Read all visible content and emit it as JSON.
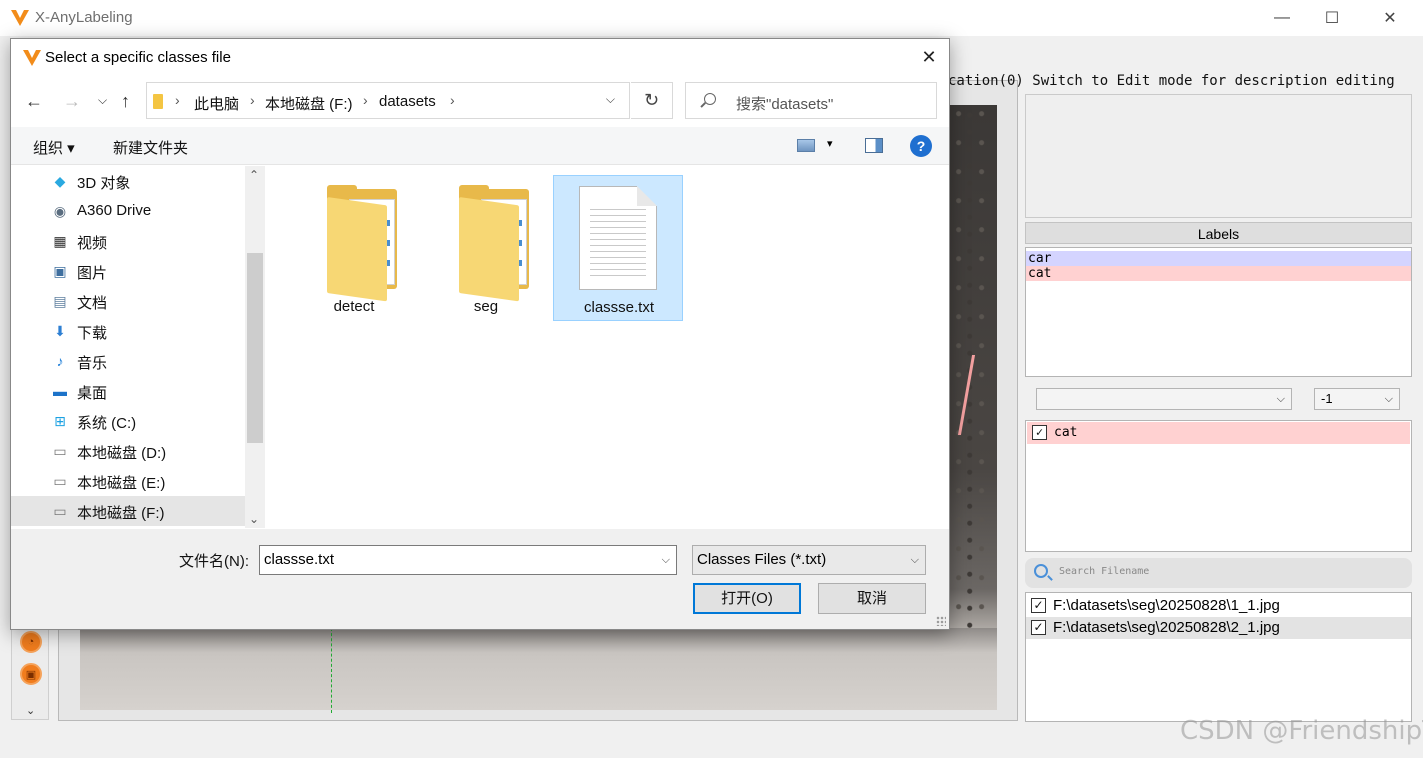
{
  "app": {
    "title": "X-AnyLabeling",
    "minimize": "—",
    "maximize": "☐",
    "close": "✕"
  },
  "main": {
    "hint": "cation(0) Switch to Edit mode for description editing",
    "labels_header": "Labels",
    "labels": [
      {
        "name": "car",
        "color": "#d4d4ff"
      },
      {
        "name": "cat",
        "color": "#ffd1d1"
      }
    ],
    "group_combo": "",
    "group_id_combo": "-1",
    "shapes": [
      {
        "label": "cat",
        "checked": true
      }
    ],
    "search_filename_placeholder": "Search Filename",
    "files": [
      {
        "path": "F:\\datasets\\seg\\20250828\\1_1.jpg",
        "checked": true,
        "selected": false
      },
      {
        "path": "F:\\datasets\\seg\\20250828\\2_1.jpg",
        "checked": true,
        "selected": true
      }
    ],
    "watermark": "CSDN @FriendshipT"
  },
  "dialog": {
    "title": "Select a specific classes file",
    "breadcrumb": [
      "此电脑",
      "本地磁盘 (F:)",
      "datasets"
    ],
    "search_placeholder": "搜索\"datasets\"",
    "toolbar": {
      "organize": "组织 ▾",
      "new_folder": "新建文件夹",
      "help": "?"
    },
    "nav_items": [
      {
        "label": "3D 对象",
        "icon": "cube-icon",
        "glyph": "◆",
        "color": "#2aa9e0"
      },
      {
        "label": "A360 Drive",
        "icon": "cloud-drive-icon",
        "glyph": "◉",
        "color": "#5a6d80"
      },
      {
        "label": "视频",
        "icon": "video-icon",
        "glyph": "▦",
        "color": "#333333"
      },
      {
        "label": "图片",
        "icon": "picture-icon",
        "glyph": "▣",
        "color": "#3f6f9f"
      },
      {
        "label": "文档",
        "icon": "document-icon",
        "glyph": "▤",
        "color": "#5f7f9f"
      },
      {
        "label": "下载",
        "icon": "download-icon",
        "glyph": "⬇",
        "color": "#2d7fd3"
      },
      {
        "label": "音乐",
        "icon": "music-icon",
        "glyph": "♪",
        "color": "#1e7ed8"
      },
      {
        "label": "桌面",
        "icon": "desktop-icon",
        "glyph": "▬",
        "color": "#1d73c9"
      },
      {
        "label": "系统 (C:)",
        "icon": "windows-drive-icon",
        "glyph": "⊞",
        "color": "#1ba1e2"
      },
      {
        "label": "本地磁盘 (D:)",
        "icon": "drive-icon",
        "glyph": "▭",
        "color": "#777777"
      },
      {
        "label": "本地磁盘 (E:)",
        "icon": "drive-icon",
        "glyph": "▭",
        "color": "#777777"
      },
      {
        "label": "本地磁盘 (F:)",
        "icon": "drive-icon",
        "glyph": "▭",
        "color": "#777777"
      }
    ],
    "selected_nav": "本地磁盘 (F:)",
    "files": [
      {
        "name": "detect",
        "type": "folder"
      },
      {
        "name": "seg",
        "type": "folder"
      },
      {
        "name": "classse.txt",
        "type": "text-file",
        "selected": true
      }
    ],
    "filename_label": "文件名(N):",
    "filename_value": "classse.txt",
    "filter": "Classes Files (*.txt)",
    "open_button": "打开(O)",
    "cancel_button": "取消"
  }
}
